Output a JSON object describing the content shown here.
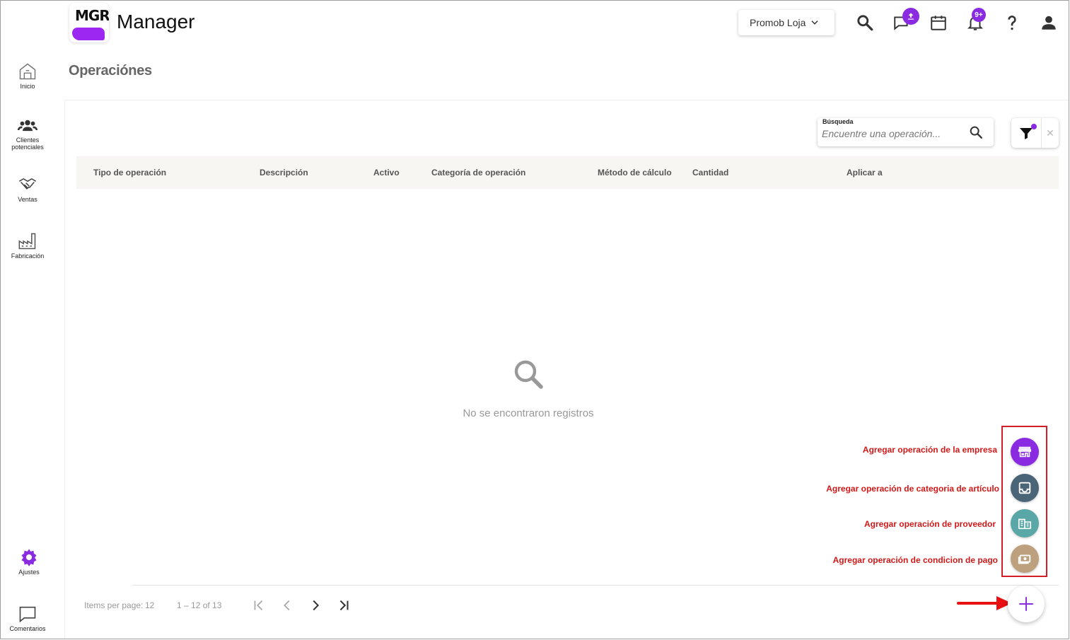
{
  "header": {
    "logo_text": "MGR",
    "app_title": "Manager",
    "store_selector": "Promob Loja",
    "notification_badge": "9+",
    "icons": [
      "search-icon",
      "chat-upload-icon",
      "calendar-icon",
      "bell-icon",
      "help-icon",
      "user-icon"
    ]
  },
  "sidebar": {
    "items": [
      {
        "label": "Inicio",
        "icon": "home-icon"
      },
      {
        "label": "Clientes potenciales",
        "icon": "people-icon"
      },
      {
        "label": "Ventas",
        "icon": "handshake-icon"
      },
      {
        "label": "Fabricación",
        "icon": "factory-icon"
      }
    ],
    "bottom": [
      {
        "label": "Ajustes",
        "icon": "gear-icon"
      },
      {
        "label": "Comentarios",
        "icon": "comment-icon"
      }
    ]
  },
  "page": {
    "title": "Operaciónes"
  },
  "search": {
    "label": "Búsqueda",
    "placeholder": "Encuentre una operación..."
  },
  "table": {
    "columns": [
      "Tipo de operación",
      "Descripción",
      "Activo",
      "Categoría de operación",
      "Método de cálculo",
      "Cantidad",
      "Aplicar a"
    ],
    "empty_message": "No se encontraron registros"
  },
  "pagination": {
    "items_per_page_label": "Items per page:",
    "items_per_page": "12",
    "range": "1 – 12 of 13"
  },
  "fab_actions": [
    {
      "label": "Agregar operación de la empresa",
      "color": "#8a2be2",
      "icon": "store-icon"
    },
    {
      "label": "Agregar operación de categoria de artículo",
      "color": "#4a6478",
      "icon": "inbox-icon"
    },
    {
      "label": "Agregar operación de proveedor",
      "color": "#5aa7a7",
      "icon": "building-icon"
    },
    {
      "label": "Agregar operación de condicion de pago",
      "color": "#bda07d",
      "icon": "money-icon"
    }
  ],
  "colors": {
    "accent": "#8a2be2",
    "annotation_red": "#d21f27",
    "table_header_bg": "#f8f6f3"
  }
}
